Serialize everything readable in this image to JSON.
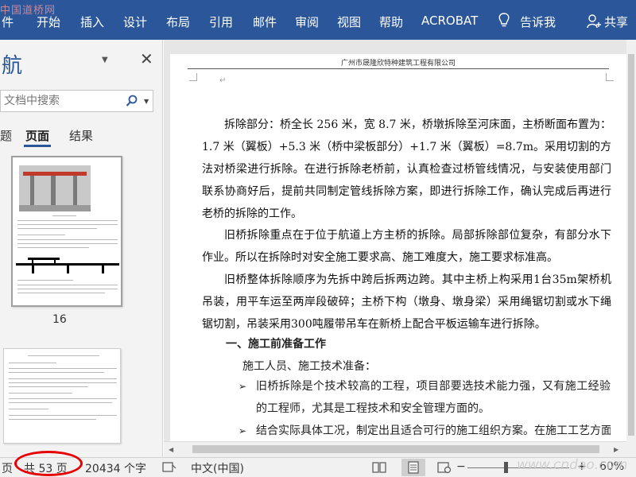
{
  "watermark_top": "中国道桥网",
  "ribbon": {
    "tabs": [
      "件",
      "开始",
      "插入",
      "设计",
      "布局",
      "引用",
      "邮件",
      "审阅",
      "视图",
      "帮助",
      "ACROBAT"
    ],
    "tell_me": "告诉我",
    "share": "共享",
    "color": "#2b579a"
  },
  "nav": {
    "title": "航",
    "search_placeholder": "文档中搜索",
    "tabs": [
      "题",
      "页面",
      "结果"
    ],
    "active_tab": "页面",
    "thumb_page_number": "16"
  },
  "doc": {
    "header_text": "广州市晟隆欣特种建筑工程有限公司",
    "para1": "拆除部分：桥全长 256 米，宽 8.7 米，桥墩拆除至河床面，主桥断面布置为：1.7 米（翼板）+5.3 米（桥中梁板部分）+1.7 米（翼板）=8.7m。采用切割的方法对桥梁进行拆除。在进行拆除老桥前，认真检查过桥管线情况，与安装使用部门联系协商好后，提前共同制定管线拆除方案，即进行拆除工作，确认完成后再进行老桥的拆除的工作。",
    "para2": "旧桥拆除重点在于位于航道上方主桥的拆除。局部拆除部位复杂，有部分水下作业。所以在拆除时对安全施工要求高、施工难度大，施工要求标准高。",
    "para3": "旧桥整体拆除顺序为先拆中跨后拆两边跨。其中主桥上构采用1台35m架桥机吊装，用平车运至两岸段破碎；主桥下构（墩身、墩身梁）采用绳锯切割或水下绳锯切割，吊装采用300吨履带吊车在新桥上配合平板运输车进行拆除。",
    "heading1": "一、施工前准备工作",
    "subheading": "施工人员、施工技术准备：",
    "bullets": [
      "旧桥拆除是个技术较高的工程，项目部要选技术能力强，又有施工经验的工程师，尤其是工程技术和安全管理方面的。",
      "结合实际具体工况，制定出且适合可行的施工组织方案。在施工工艺方面"
    ]
  },
  "status": {
    "page_prefix": "页",
    "page_count": "共 53 页",
    "word_count": "20434 个字",
    "language": "中文(中国)",
    "zoom_minus": "−",
    "zoom_plus": "+",
    "zoom": "60%",
    "site_watermark": "www.cndao.com"
  }
}
